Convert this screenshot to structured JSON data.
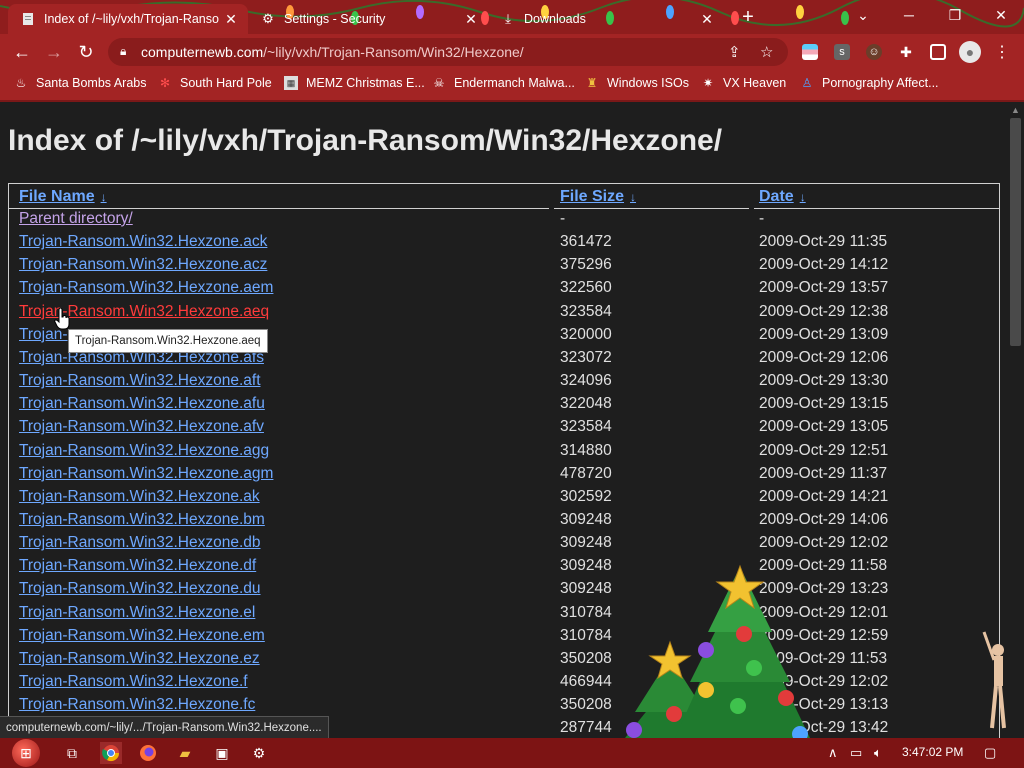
{
  "tabs": [
    {
      "title": "Index of /~lily/vxh/Trojan-Ranso",
      "icon": "page-icon",
      "active": true
    },
    {
      "title": "Settings - Security",
      "icon": "gear-icon",
      "active": false
    },
    {
      "title": "Downloads",
      "icon": "download-icon",
      "active": false
    }
  ],
  "omnibox": {
    "host": "computernewb.com",
    "path": "/~lily/vxh/Trojan-Ransom/Win32/Hexzone/"
  },
  "bookmarks": [
    {
      "label": "Santa Bombs Arabs",
      "icon": "bomb-icon"
    },
    {
      "label": "South Hard Pole",
      "icon": "snowflake-icon"
    },
    {
      "label": "MEMZ Christmas E...",
      "icon": "page-icon"
    },
    {
      "label": "Endermanch Malwa...",
      "icon": "skull-icon"
    },
    {
      "label": "Windows ISOs",
      "icon": "folder-icon"
    },
    {
      "label": "VX Heaven",
      "icon": "virus-icon"
    },
    {
      "label": "Pornography Affect...",
      "icon": "person-icon"
    }
  ],
  "page": {
    "heading": "Index of /~lily/vxh/Trojan-Ransom/Win32/Hexzone/",
    "columns": {
      "name": "File Name",
      "size": "File Size",
      "date": "Date"
    },
    "sort_arrow": "↓",
    "rows": [
      {
        "name": "Parent directory/",
        "size": "-",
        "date": "-"
      },
      {
        "name": "Trojan-Ransom.Win32.Hexzone.ack",
        "size": "361472",
        "date": "2009-Oct-29 11:35"
      },
      {
        "name": "Trojan-Ransom.Win32.Hexzone.acz",
        "size": "375296",
        "date": "2009-Oct-29 14:12"
      },
      {
        "name": "Trojan-Ransom.Win32.Hexzone.aem",
        "size": "322560",
        "date": "2009-Oct-29 13:57"
      },
      {
        "name": "Trojan-Ransom.Win32.Hexzone.aeq",
        "size": "323584",
        "date": "2009-Oct-29 12:38"
      },
      {
        "name": "Trojan-",
        "size": "320000",
        "date": "2009-Oct-29 13:09"
      },
      {
        "name": "Trojan-Ransom.Win32.Hexzone.afs",
        "size": "323072",
        "date": "2009-Oct-29 12:06"
      },
      {
        "name": "Trojan-Ransom.Win32.Hexzone.aft",
        "size": "324096",
        "date": "2009-Oct-29 13:30"
      },
      {
        "name": "Trojan-Ransom.Win32.Hexzone.afu",
        "size": "322048",
        "date": "2009-Oct-29 13:15"
      },
      {
        "name": "Trojan-Ransom.Win32.Hexzone.afv",
        "size": "323584",
        "date": "2009-Oct-29 13:05"
      },
      {
        "name": "Trojan-Ransom.Win32.Hexzone.agg",
        "size": "314880",
        "date": "2009-Oct-29 12:51"
      },
      {
        "name": "Trojan-Ransom.Win32.Hexzone.agm",
        "size": "478720",
        "date": "2009-Oct-29 11:37"
      },
      {
        "name": "Trojan-Ransom.Win32.Hexzone.ak",
        "size": "302592",
        "date": "2009-Oct-29 14:21"
      },
      {
        "name": "Trojan-Ransom.Win32.Hexzone.bm",
        "size": "309248",
        "date": "2009-Oct-29 14:06"
      },
      {
        "name": "Trojan-Ransom.Win32.Hexzone.db",
        "size": "309248",
        "date": "2009-Oct-29 12:02"
      },
      {
        "name": "Trojan-Ransom.Win32.Hexzone.df",
        "size": "309248",
        "date": "2009-Oct-29 11:58"
      },
      {
        "name": "Trojan-Ransom.Win32.Hexzone.du",
        "size": "309248",
        "date": "2009-Oct-29 13:23"
      },
      {
        "name": "Trojan-Ransom.Win32.Hexzone.el",
        "size": "310784",
        "date": "2009-Oct-29 12:01"
      },
      {
        "name": "Trojan-Ransom.Win32.Hexzone.em",
        "size": "310784",
        "date": "2009-Oct-29 12:59"
      },
      {
        "name": "Trojan-Ransom.Win32.Hexzone.ez",
        "size": "350208",
        "date": "2009-Oct-29 11:53"
      },
      {
        "name": "Trojan-Ransom.Win32.Hexzone.f",
        "size": "466944",
        "date": "2009-Oct-29 12:02"
      },
      {
        "name": "Trojan-Ransom.Win32.Hexzone.fc",
        "size": "350208",
        "date": "2009-Oct-29 13:13"
      },
      {
        "name": "",
        "size": "287744",
        "date": "2009-Oct-29 13:42"
      }
    ],
    "tooltip": "Trojan-Ransom.Win32.Hexzone.aeq"
  },
  "status_bar": "computernewb.com/~lily/.../Trojan-Ransom.Win32.Hexzone....",
  "taskbar": {
    "clock": "3:47:02 PM"
  },
  "colors": {
    "tabstrip": "#8f1d1d",
    "toolbar": "#a32424",
    "link": "#6ea8ff",
    "visited": "#c4a3e8",
    "hover": "#ff3b3b"
  }
}
